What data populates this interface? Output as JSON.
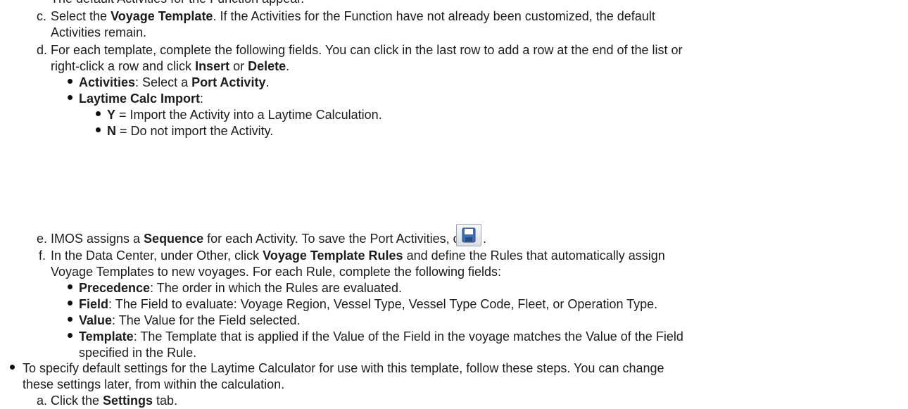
{
  "fragment_top": "The default Activities for the Function appear.",
  "step_c": {
    "marker": "c.",
    "l1_pre": "Select the ",
    "l1_b1": "Voyage Template",
    "l1_post": ". If the Activities for the Function have not already been customized, the default",
    "l2": "Activities remain."
  },
  "step_d": {
    "marker": "d.",
    "l1": "For each template, complete the following fields. You can click in the last row to add a row at the end of the list or",
    "l2_pre": "right-click a row and click ",
    "l2_b1": "Insert",
    "l2_mid": " or ",
    "l2_b2": "Delete",
    "l2_post": ".",
    "activities_b": "Activities",
    "activities_mid": ": Select a ",
    "activities_b2": "Port Activity",
    "activities_post": ".",
    "laytime_b": "Laytime Calc Import",
    "laytime_post": ":",
    "y_b": "Y",
    "y_post": " = Import the Activity into a Laytime Calculation.",
    "n_b": "N",
    "n_post": " = Do not import the Activity."
  },
  "step_e": {
    "marker": "e.",
    "pre": "IMOS assigns a ",
    "b1": "Sequence",
    "post": " for each Activity. To save the Port Activities, click",
    "end": ".",
    "icon": "save-icon"
  },
  "step_f": {
    "marker": "f.",
    "l1_pre": "In the Data Center, under Other, click ",
    "l1_b1": "Voyage Template Rules",
    "l1_post": " and define the Rules that automatically assign",
    "l2": "Voyage Templates to new voyages. For each Rule, complete the following fields:",
    "precedence_b": "Precedence",
    "precedence_post": ": The order in which the Rules are evaluated.",
    "field_b": "Field",
    "field_post": ": The Field to evaluate: Voyage Region, Vessel Type, Vessel Type Code, Fleet, or Operation Type.",
    "value_b": "Value",
    "value_post": ": The Value for the Field selected.",
    "template_b": "Template",
    "template_post": ": The Template that is applied if the Value of the Field in the voyage matches the Value of the Field",
    "template_l2": "specified in the Rule."
  },
  "bullet_laytime": {
    "l1": "To specify default settings for the Laytime Calculator for use with this template, follow these steps. You can change",
    "l2": "these settings later, from within the calculation."
  },
  "step_a": {
    "marker": "a.",
    "pre": "Click the ",
    "b1": "Settings",
    "post": " tab."
  }
}
